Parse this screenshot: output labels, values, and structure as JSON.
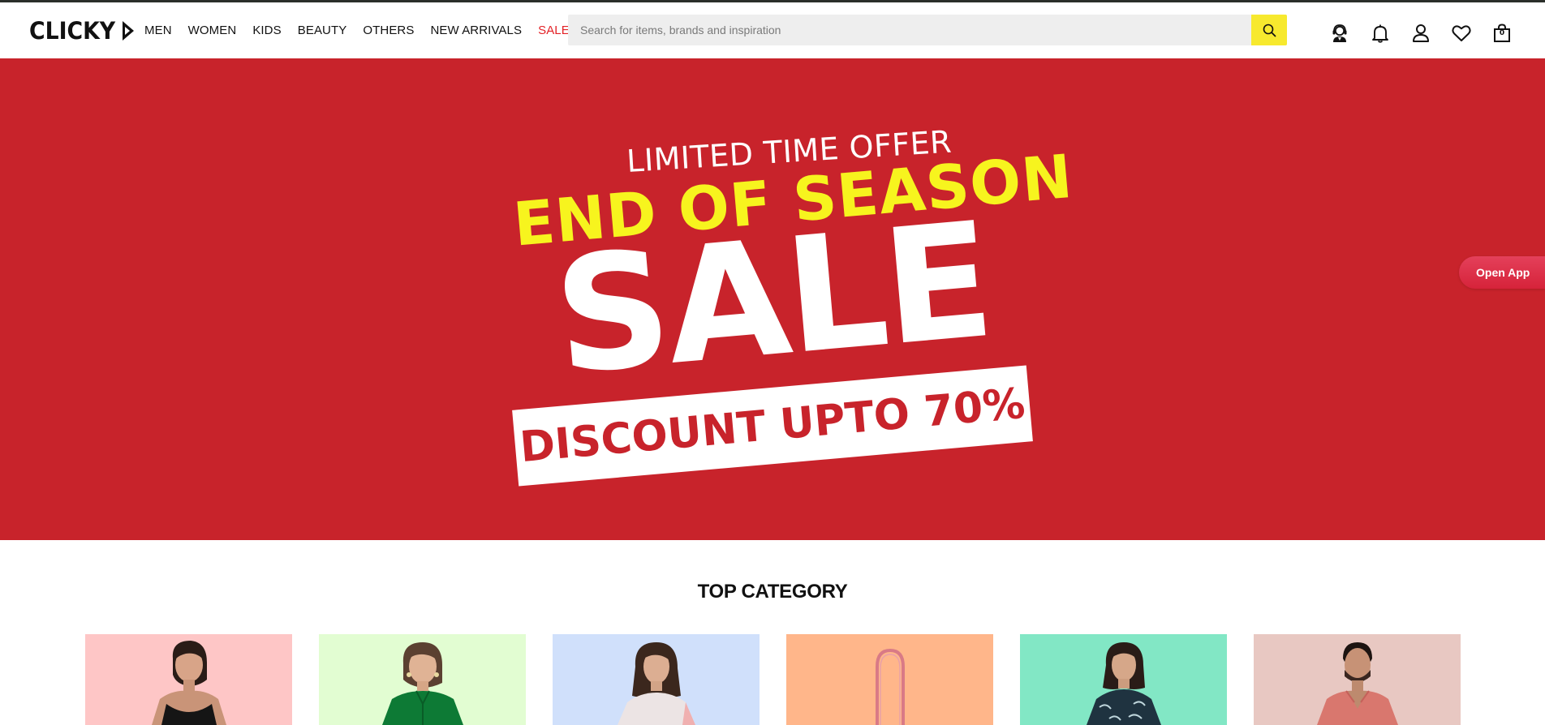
{
  "brand": {
    "name": "CLICKY"
  },
  "nav": {
    "items": [
      {
        "label": "MEN"
      },
      {
        "label": "WOMEN"
      },
      {
        "label": "KIDS"
      },
      {
        "label": "BEAUTY"
      },
      {
        "label": "OTHERS"
      },
      {
        "label": "NEW ARRIVALS"
      },
      {
        "label": "SALE",
        "accent": "#e32227"
      }
    ]
  },
  "search": {
    "placeholder": "Search for items, brands and inspiration",
    "value": "",
    "button_color": "#f7e92e"
  },
  "header_icons": [
    {
      "name": "support-icon"
    },
    {
      "name": "bell-icon"
    },
    {
      "name": "user-icon"
    },
    {
      "name": "heart-icon"
    },
    {
      "name": "cart-icon",
      "count": "0"
    }
  ],
  "hero": {
    "background": "#c8232b",
    "line1": "LIMITED TIME OFFER",
    "line2": "END OF SEASON",
    "line3": "SALE",
    "line4": "DISCOUNT UPTO 70%"
  },
  "open_app": {
    "label": "Open App"
  },
  "top_category": {
    "title": "TOP CATEGORY",
    "cards": [
      {
        "bg": "#fec6c6"
      },
      {
        "bg": "#e2fdd2"
      },
      {
        "bg": "#d0e0fb"
      },
      {
        "bg": "#ffb68a"
      },
      {
        "bg": "#82e7c5"
      },
      {
        "bg": "#e8c8c2"
      }
    ]
  }
}
